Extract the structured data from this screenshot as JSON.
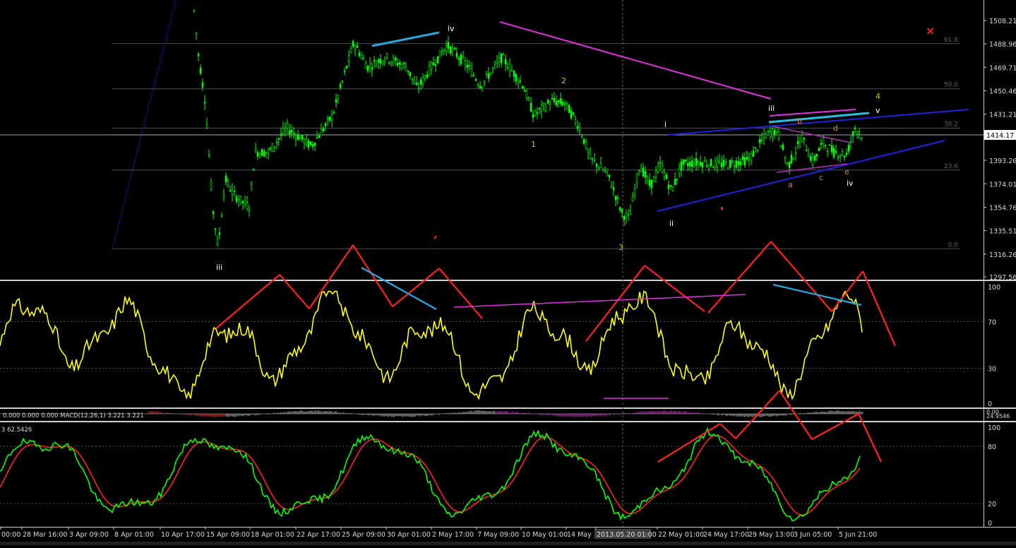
{
  "chart_data": [
    {
      "panel": "price",
      "type": "candlestick",
      "colors": {
        "bull": "#00ff00",
        "bear": "#00ff00",
        "grid": "#2f2f2f"
      },
      "y_ticks": [
        "1508.21",
        "1488.96",
        "1469.71",
        "1450.46",
        "1431.21",
        "1414.17",
        "1393.26",
        "1374.01",
        "1354.76",
        "1335.51",
        "1316.26",
        "1297.56"
      ],
      "ylim": [
        1297.56,
        1508.21
      ],
      "current_price": "1414.17",
      "fib_levels": [
        {
          "label": "61.8",
          "value": 1489.2
        },
        {
          "label": "50.0",
          "value": 1452.1
        },
        {
          "label": "38.2",
          "value": 1419.8
        },
        {
          "label": "23.6",
          "value": 1385.3
        },
        {
          "label": "0.0",
          "value": 1320.6
        }
      ],
      "wave_labels": [
        {
          "text": "iv",
          "t": [
            0.06,
            0.87
          ],
          "color": "#ffffff"
        },
        {
          "text": "iii",
          "t": [
            0.12,
            0.88
          ],
          "color": "#ffffff"
        },
        {
          "text": "2",
          "t": [
            0.55,
            0.52
          ],
          "color": "#c8c800"
        },
        {
          "text": "1",
          "t": [
            0.53,
            0.6
          ],
          "color": "#c8c800"
        },
        {
          "text": "3",
          "t": [
            0.61,
            0.02
          ],
          "color": "#c8c800"
        },
        {
          "text": "i",
          "t": [
            0.66,
            0.68
          ],
          "color": "#ffffff"
        },
        {
          "text": "ii",
          "t": [
            0.66,
            0.1
          ],
          "color": "#ffffff"
        },
        {
          "text": "iii",
          "t": [
            0.76,
            0.74
          ],
          "color": "#ffffff"
        },
        {
          "text": "iv",
          "t": [
            0.84,
            0.2
          ],
          "color": "#ffffff"
        },
        {
          "text": "v",
          "t": [
            0.87,
            0.64
          ],
          "color": "#ffffff"
        },
        {
          "text": "4",
          "t": [
            0.86,
            0.69
          ],
          "color": "#c8c800"
        },
        {
          "text": "a",
          "t": [
            0.78,
            0.28
          ],
          "color": "#e08a20"
        },
        {
          "text": "b",
          "t": [
            0.79,
            0.62
          ],
          "color": "#e08a20"
        },
        {
          "text": "c",
          "t": [
            0.81,
            0.33
          ],
          "color": "#e08a20"
        },
        {
          "text": "d",
          "t": [
            0.82,
            0.58
          ],
          "color": "#e08a20"
        },
        {
          "text": "e",
          "t": [
            0.83,
            0.38
          ],
          "color": "#e08a20"
        }
      ],
      "wave_label_times": [
        "2 May 17:00",
        "15 Apr 09:00",
        "9 May 12:00",
        "8 May 22:00",
        "20 May 01:00",
        "21 May 20:00",
        "22 May 01:00",
        "29 May 13:00",
        "5 Jun 13:00",
        "5 Jun 21:00",
        "5 Jun 21:00",
        "30 May 15:00",
        "31 May 07:00",
        "3 Jun 05:00",
        "4 Jun 05:00",
        "5 Jun 10:00"
      ],
      "wave_label_values": [
        1500,
        1316,
        1458,
        1400,
        1318,
        1420,
        1345,
        1433,
        1376,
        1432,
        1447,
        1380,
        1421,
        1383,
        1419,
        1386
      ]
    },
    {
      "panel": "oscillator",
      "type": "line",
      "color": "#ffff00",
      "y_ticks": [
        "100",
        "70",
        "30",
        "0"
      ],
      "levels": [
        70,
        30
      ]
    },
    {
      "panel": "macd",
      "type": "histogram",
      "legend": "0.000 0.000 0.000  MACD(12,26,1) 3.221 3.221",
      "right_label": "24.9546",
      "right_label_top": "0.00"
    },
    {
      "panel": "stochastic",
      "type": "line",
      "legend": "3 62.5426",
      "series_colors": [
        "#00ff00",
        "#ff2020"
      ],
      "y_ticks": [
        "100",
        "80",
        "20",
        "0"
      ],
      "levels": [
        80,
        20
      ]
    }
  ],
  "x_axis": {
    "labels": [
      "00:00",
      "28 Mar 16:00",
      "3 Apr 09:00",
      "8 Apr 01:00",
      "10 Apr 17:00",
      "15 Apr 09:00",
      "18 Apr 01:00",
      "22 Apr 17:00",
      "25 Apr 09:00",
      "30 Apr 01:00",
      "2 May 17:00",
      "7 May 09:00",
      "10 May 01:00",
      "14 May 1",
      "2013.05.20 01:00",
      "22 May 01:00",
      "24 May 17:00",
      "29 May 13:00",
      "3 Jun 05:00",
      "5 Jun 21:00"
    ],
    "highlight": "2013.05.20 01:00"
  },
  "close_marker": "×"
}
